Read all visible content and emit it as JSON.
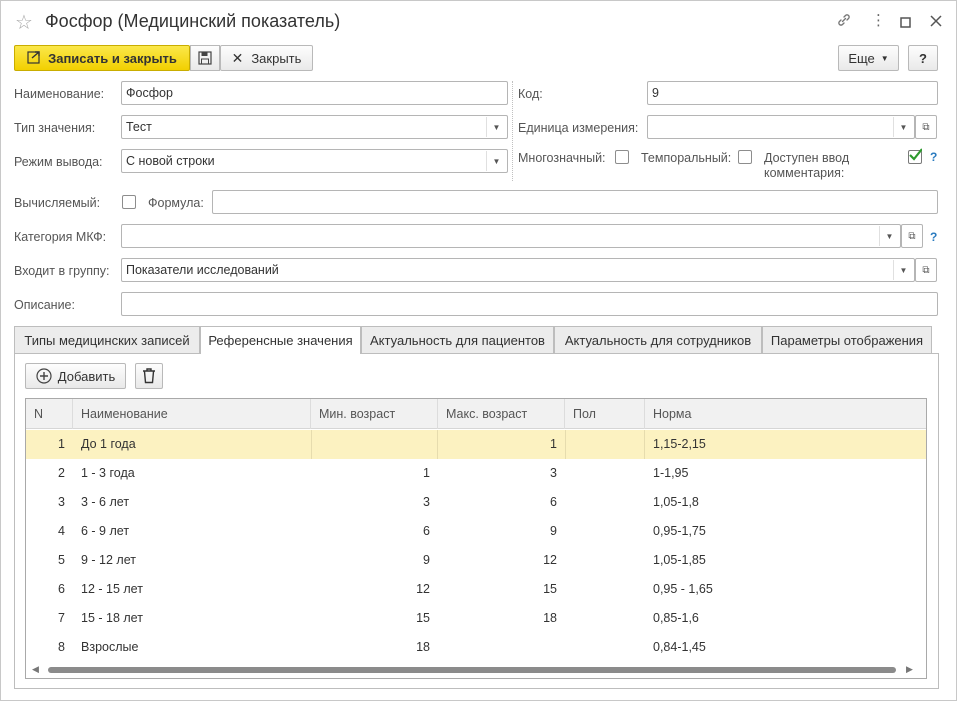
{
  "window": {
    "title": "Фосфор (Медицинский показатель)"
  },
  "toolbar": {
    "save_close": "Записать и закрыть",
    "close": "Закрыть",
    "more": "Еще",
    "help": "?"
  },
  "form": {
    "name_label": "Наименование:",
    "name_value": "Фосфор",
    "code_label": "Код:",
    "code_value": "9",
    "value_type_label": "Тип значения:",
    "value_type_value": "Тест",
    "unit_label": "Единица измерения:",
    "unit_value": "",
    "output_mode_label": "Режим вывода:",
    "output_mode_value": "С новой строки",
    "multivalue_label": "Многозначный:",
    "multivalue_checked": false,
    "temporal_label": "Темпоральный:",
    "temporal_checked": false,
    "comment_label_1": "Доступен ввод",
    "comment_label_2": "комментария:",
    "comment_checked": true,
    "calculated_label": "Вычисляемый:",
    "calculated_checked": false,
    "formula_label": "Формула:",
    "formula_value": "",
    "icd_label": "Категория МКФ:",
    "icd_value": "",
    "group_label": "Входит в группу:",
    "group_value": "Показатели исследований",
    "description_label": "Описание:",
    "description_value": "",
    "help_mark": "?"
  },
  "tabs": [
    {
      "label": "Типы медицинских записей",
      "active": false
    },
    {
      "label": "Референсные значения",
      "active": true
    },
    {
      "label": "Актуальность для пациентов",
      "active": false
    },
    {
      "label": "Актуальность для сотрудников",
      "active": false
    },
    {
      "label": "Параметры отображения",
      "active": false
    }
  ],
  "panel": {
    "add_label": "Добавить"
  },
  "table": {
    "columns": [
      "N",
      "Наименование",
      "Мин. возраст",
      "Макс. возраст",
      "Пол",
      "Норма"
    ],
    "rows": [
      {
        "n": "1",
        "name": "До 1 года",
        "min": "",
        "max": "1",
        "sex": "",
        "norm": "1,15-2,15",
        "selected": true
      },
      {
        "n": "2",
        "name": "1 - 3 года",
        "min": "1",
        "max": "3",
        "sex": "",
        "norm": "1-1,95"
      },
      {
        "n": "3",
        "name": "3 - 6 лет",
        "min": "3",
        "max": "6",
        "sex": "",
        "norm": "1,05-1,8"
      },
      {
        "n": "4",
        "name": "6 - 9 лет",
        "min": "6",
        "max": "9",
        "sex": "",
        "norm": "0,95-1,75"
      },
      {
        "n": "5",
        "name": "9 - 12 лет",
        "min": "9",
        "max": "12",
        "sex": "",
        "norm": "1,05-1,85"
      },
      {
        "n": "6",
        "name": "12 - 15 лет",
        "min": "12",
        "max": "15",
        "sex": "",
        "norm": "0,95 - 1,65"
      },
      {
        "n": "7",
        "name": "15 - 18 лет",
        "min": "15",
        "max": "18",
        "sex": "",
        "norm": "0,85-1,6"
      },
      {
        "n": "8",
        "name": "Взрослые",
        "min": "18",
        "max": "",
        "sex": "",
        "norm": "0,84-1,45"
      }
    ]
  }
}
